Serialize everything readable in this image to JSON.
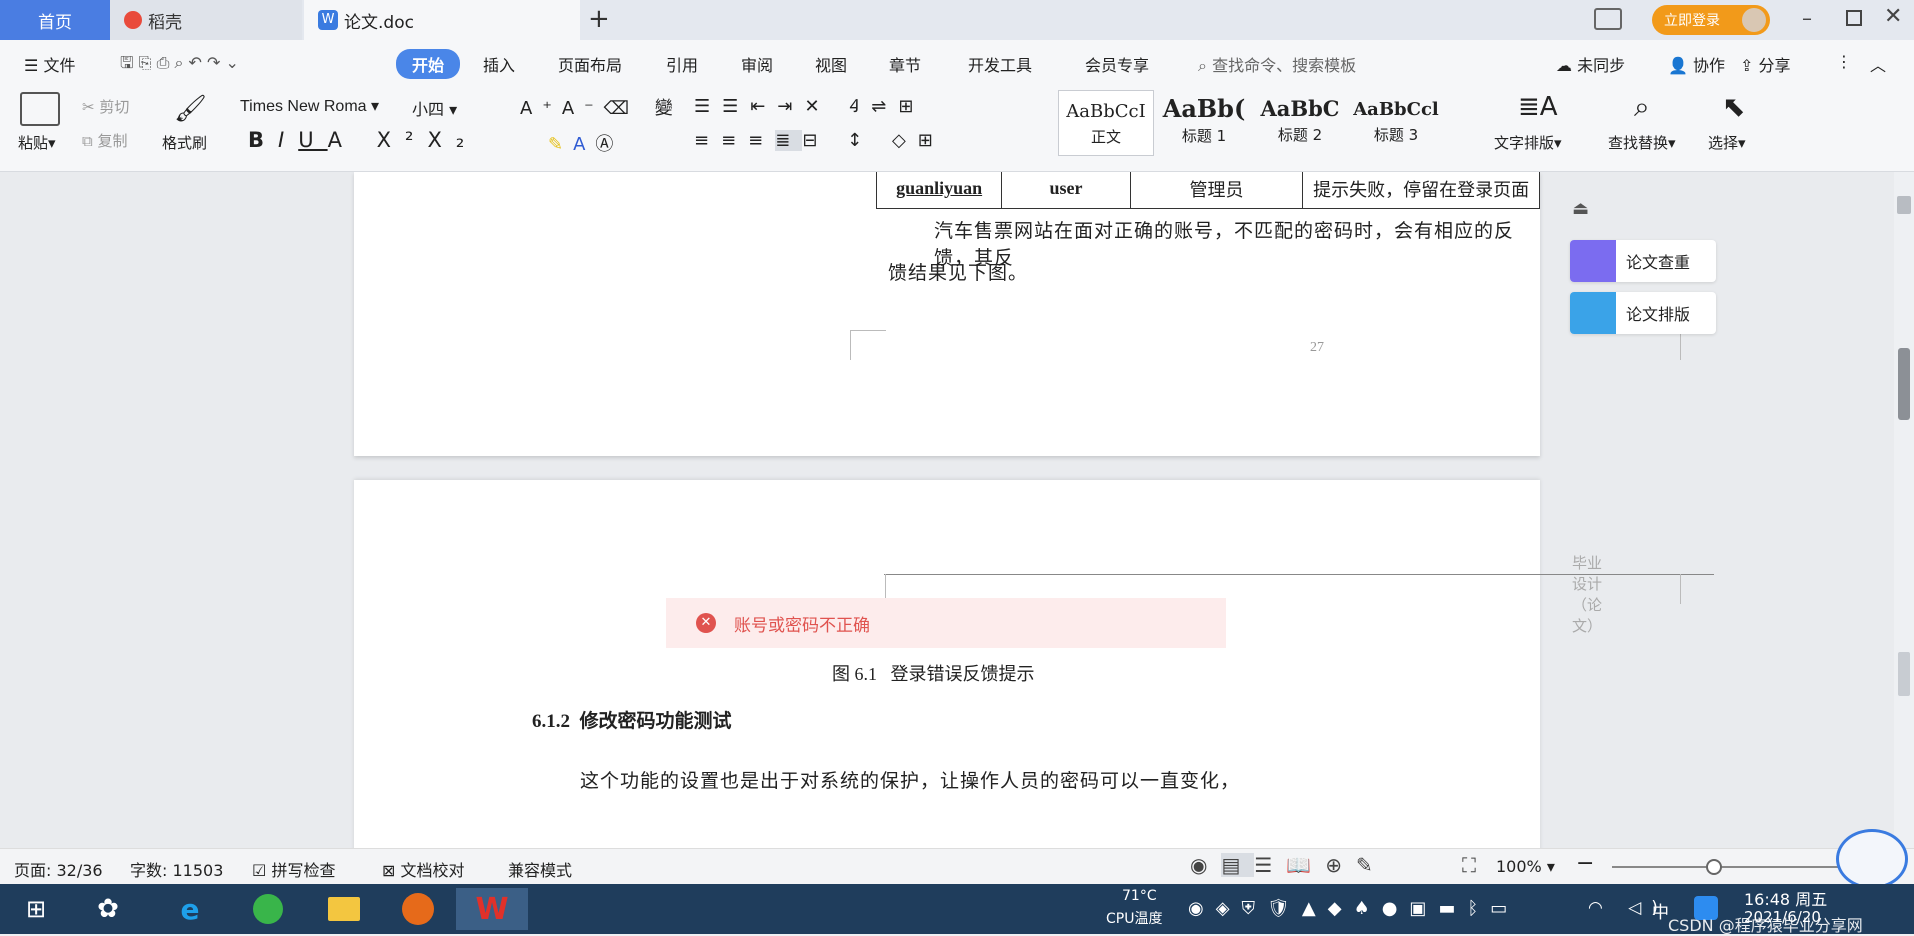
{
  "tabs": {
    "home": "首页",
    "daoke": "稻壳",
    "doc": "论文.doc",
    "login": "立即登录"
  },
  "menu": {
    "file": "文件",
    "items": [
      "开始",
      "插入",
      "页面布局",
      "引用",
      "审阅",
      "视图",
      "章节",
      "开发工具",
      "会员专享"
    ],
    "search_placeholder": "查找命令、搜索模板",
    "sync": "未同步",
    "collab": "协作",
    "share": "分享"
  },
  "ribbon": {
    "paste": "粘贴",
    "cut": "剪切",
    "copy": "复制",
    "format_painter": "格式刷",
    "font_name": "Times New Roma",
    "font_size": "小四",
    "styles": [
      {
        "preview": "AaBbCcI",
        "name": "正文"
      },
      {
        "preview": "AaBb(",
        "name": "标题 1"
      },
      {
        "preview": "AaBbC",
        "name": "标题 2"
      },
      {
        "preview": "AaBbCcl",
        "name": "标题 3"
      }
    ],
    "text_layout": "文字排版",
    "find_replace": "查找替换",
    "select": "选择"
  },
  "document": {
    "table_row": [
      "guanliyuan",
      "user",
      "管理员",
      "提示失败，停留在登录页面"
    ],
    "para1_line1": "汽车售票网站在面对正确的账号，不匹配的密码时，会有相应的反馈，其反",
    "para1_line2": "馈结果见下图。",
    "page_number": "27",
    "header": "毕业设计（论文）",
    "error_toast": "账号或密码不正确",
    "figure_caption": "图 6.1   登录错误反馈提示",
    "section_heading": "6.1.2  修改密码功能测试",
    "para2": "这个功能的设置也是出于对系统的保护，让操作人员的密码可以一直变化，"
  },
  "side_panel": {
    "check": "论文查重",
    "layout": "论文排版"
  },
  "status": {
    "page": "页面: 32/36",
    "words": "字数: 11503",
    "spell": "拼写检查",
    "proof": "文档校对",
    "compat": "兼容模式",
    "zoom": "100%"
  },
  "taskbar": {
    "temp": "71°C",
    "cpu": "CPU温度",
    "time": "16:48 周五",
    "date": "2021/6/20",
    "ime": "中",
    "watermark": "CSDN @程序猿毕业分享网"
  },
  "colors": {
    "accent": "#4a86e8",
    "home_tab": "#4a7de2",
    "login": "#f29a1a",
    "taskbar": "#1f3d5c",
    "error_bg": "#fdecec",
    "error_text": "#e0534f"
  }
}
